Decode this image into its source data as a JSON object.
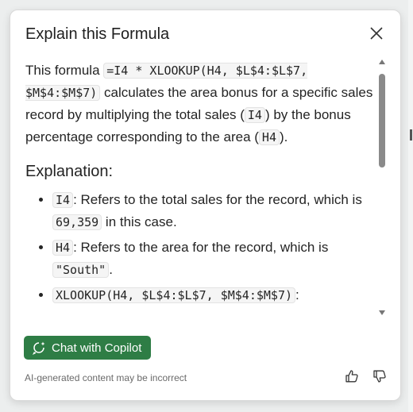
{
  "panel": {
    "title": "Explain this Formula",
    "close_icon": "close-icon"
  },
  "intro": {
    "p1": "This formula ",
    "formula": "=I4 * XLOOKUP(H4, $L$4:$L$7, $M$4:$M$7)",
    "p2": " calculates the area bonus for a specific sales record by multiplying the total sales (",
    "code_i4": "I4",
    "p3": ") by the bonus percentage corresponding to the area (",
    "code_h4": "H4",
    "p4": ")."
  },
  "explanation": {
    "heading": "Explanation:",
    "items": [
      {
        "code": "I4",
        "text_a": ": Refers to the total sales for the record, which is ",
        "code2": "69,359",
        "text_b": " in this case."
      },
      {
        "code": "H4",
        "text_a": ": Refers to the area for the record, which is ",
        "code2": "\"South\"",
        "text_b": "."
      },
      {
        "code": "XLOOKUP(H4, $L$4:$L$7, $M$4:$M$7)",
        "text_a": ":"
      }
    ]
  },
  "footer": {
    "chat_label": "Chat with Copilot",
    "disclaimer": "AI-generated content may be incorrect",
    "thumbs_up_icon": "thumbs-up-icon",
    "thumbs_down_icon": "thumbs-down-icon"
  },
  "colors": {
    "accent": "#2e7d45",
    "code_bg": "#f5f5f5"
  }
}
